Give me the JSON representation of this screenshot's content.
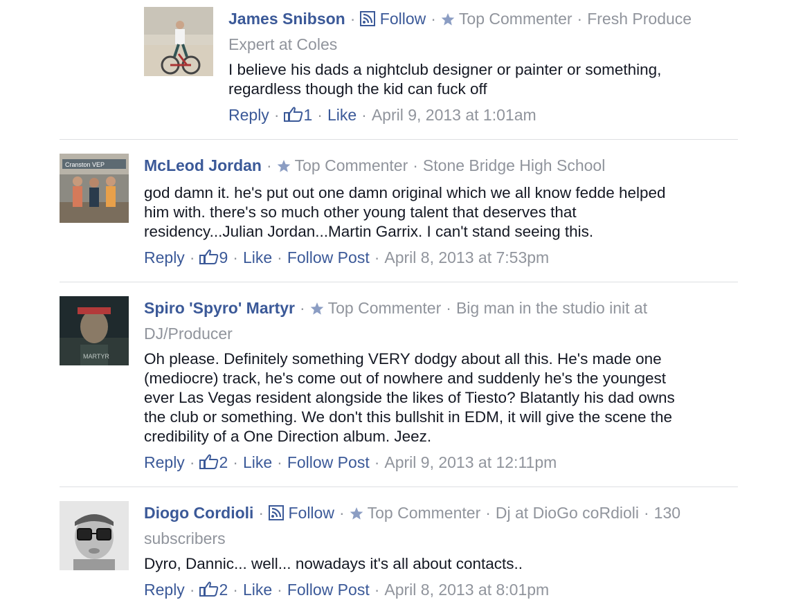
{
  "comments": [
    {
      "name": "James Snibson",
      "follow_label": "Follow",
      "badge": "Top Commenter",
      "subtitle": "Fresh Produce Expert at Coles",
      "text": "I believe his dads a nightclub designer or painter or something, regardless though the kid can fuck off",
      "reply_label": "Reply",
      "like_count": "1",
      "like_label": "Like",
      "follow_post_label": "",
      "timestamp": "April 9, 2013 at 1:01am"
    },
    {
      "name": "McLeod Jordan",
      "follow_label": "",
      "badge": "Top Commenter",
      "subtitle": "Stone Bridge High School",
      "text": "god damn it. he's put out one damn original which we all know fedde helped him with. there's so much other young talent that deserves that residency...Julian Jordan...Martin Garrix. I can't stand seeing this.",
      "reply_label": "Reply",
      "like_count": "9",
      "like_label": "Like",
      "follow_post_label": "Follow Post",
      "timestamp": "April 8, 2013 at 7:53pm"
    },
    {
      "name": "Spiro 'Spyro' Martyr",
      "follow_label": "",
      "badge": "Top Commenter",
      "subtitle": "Big man in the studio init at DJ/Producer",
      "text": "Oh please. Definitely something VERY dodgy about all this. He's made one (mediocre) track, he's come out of nowhere and suddenly he's the youngest ever Las Vegas resident alongside the likes of Tiesto? Blatantly his dad owns the club or something. We don't this bullshit in EDM, it will give the scene the credibility of a One Direction album. Jeez.",
      "reply_label": "Reply",
      "like_count": "2",
      "like_label": "Like",
      "follow_post_label": "Follow Post",
      "timestamp": "April 9, 2013 at 12:11pm"
    },
    {
      "name": "Diogo Cordioli",
      "follow_label": "Follow",
      "badge": "Top Commenter",
      "subtitle": "Dj at DioGo coRdioli",
      "subscribers": "130 subscribers",
      "text": "Dyro, Dannic... well... nowadays it's all about contacts..",
      "reply_label": "Reply",
      "like_count": "2",
      "like_label": "Like",
      "follow_post_label": "Follow Post",
      "timestamp": "April 8, 2013 at 8:01pm"
    }
  ],
  "avatar_text": {
    "mcleod": "Cranston VEP",
    "spiro": "MARTYR"
  },
  "colors": {
    "link": "#3b5998",
    "meta": "#90949c",
    "text": "#141823",
    "divider": "#dddfe2"
  },
  "icons": [
    "rss-icon",
    "star-icon",
    "thumbs-up-icon"
  ]
}
